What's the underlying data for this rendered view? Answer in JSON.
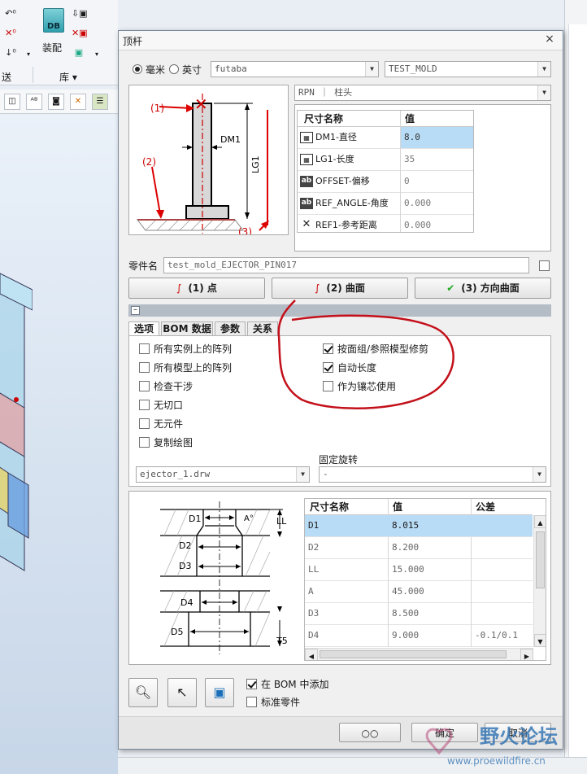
{
  "app": {
    "ribbon": {
      "assemble_label": "装配",
      "send_label": "送",
      "library_label": "库 ▾",
      "db_label": "DB"
    },
    "toolbar_icons": [
      "box-icon",
      "ab-icon",
      "camera-icon",
      "xy-icon",
      "layer-icon"
    ]
  },
  "dialog": {
    "title": "顶杆",
    "units": {
      "mm_label": "毫米",
      "inch_label": "英寸",
      "selected": "mm"
    },
    "catalog": "futaba",
    "mold": "TEST_MOLD",
    "type": "RPN ｜ 柱头",
    "param_table": {
      "headers": [
        "尺寸名称",
        "值"
      ],
      "rows": [
        {
          "icon": "calc",
          "icon_text": "▦",
          "name": "DM1-直径",
          "value": "8.0"
        },
        {
          "icon": "calc",
          "icon_text": "▦",
          "name": "LG1-长度",
          "value": "35"
        },
        {
          "icon": "ab",
          "icon_text": "ab",
          "name": "OFFSET-偏移",
          "value": "0"
        },
        {
          "icon": "ab",
          "icon_text": "ab",
          "name": "REF_ANGLE-角度",
          "value": "0.000"
        },
        {
          "icon": "x",
          "icon_text": "✕",
          "name": "REF1-参考距离",
          "value": "0.000"
        }
      ]
    },
    "diagram_labels": {
      "p1": "(1)",
      "p2": "(2)",
      "p3": "(3)",
      "dm1": "DM1",
      "lg1": "LG1"
    },
    "part_name_label": "零件名",
    "part_name_value": "test_mold_EJECTOR_PIN017",
    "buttons": {
      "point": "(1) 点",
      "surface": "(2) 曲面",
      "direction_surface": "(3) 方向曲面"
    },
    "tabs": [
      "选项",
      "BOM 数据",
      "参数",
      "关系"
    ],
    "options_left": [
      {
        "label": "所有实例上的阵列",
        "checked": false
      },
      {
        "label": "所有模型上的阵列",
        "checked": false
      },
      {
        "label": "检查干涉",
        "checked": false
      },
      {
        "label": "无切口",
        "checked": false
      },
      {
        "label": "无元件",
        "checked": false
      },
      {
        "label": "复制绘图",
        "checked": false
      }
    ],
    "options_right": [
      {
        "label": "按面组/参照模型修剪",
        "checked": true
      },
      {
        "label": "自动长度",
        "checked": true
      },
      {
        "label": "作为镶芯使用",
        "checked": false
      }
    ],
    "drawing_combo": "ejector_1.drw",
    "fixed_rotation_label": "固定旋转",
    "fixed_rotation_value": "-",
    "dim_table": {
      "headers": [
        "尺寸名称",
        "值",
        "公差"
      ],
      "rows": [
        {
          "name": "D1",
          "value": "8.015",
          "tol": ""
        },
        {
          "name": "D2",
          "value": "8.200",
          "tol": ""
        },
        {
          "name": "LL",
          "value": "15.000",
          "tol": ""
        },
        {
          "name": "A",
          "value": "45.000",
          "tol": ""
        },
        {
          "name": "D3",
          "value": "8.500",
          "tol": ""
        },
        {
          "name": "D4",
          "value": "9.000",
          "tol": "-0.1/0.1"
        }
      ]
    },
    "section_labels": {
      "d1": "D1",
      "d2": "D2",
      "d3": "D3",
      "d4": "D4",
      "d5": "D5",
      "a": "A°",
      "ll": "LL",
      "t5": "T5"
    },
    "bom_add_label": "在 BOM 中添加",
    "bom_add_checked": true,
    "standard_part_label": "标准零件",
    "standard_part_checked": false,
    "ok_label": "确定",
    "cancel_label": "取消",
    "glasses_label": "○○"
  },
  "watermark": {
    "cn": "野火论坛",
    "url": "www.proewildfire.cn"
  }
}
